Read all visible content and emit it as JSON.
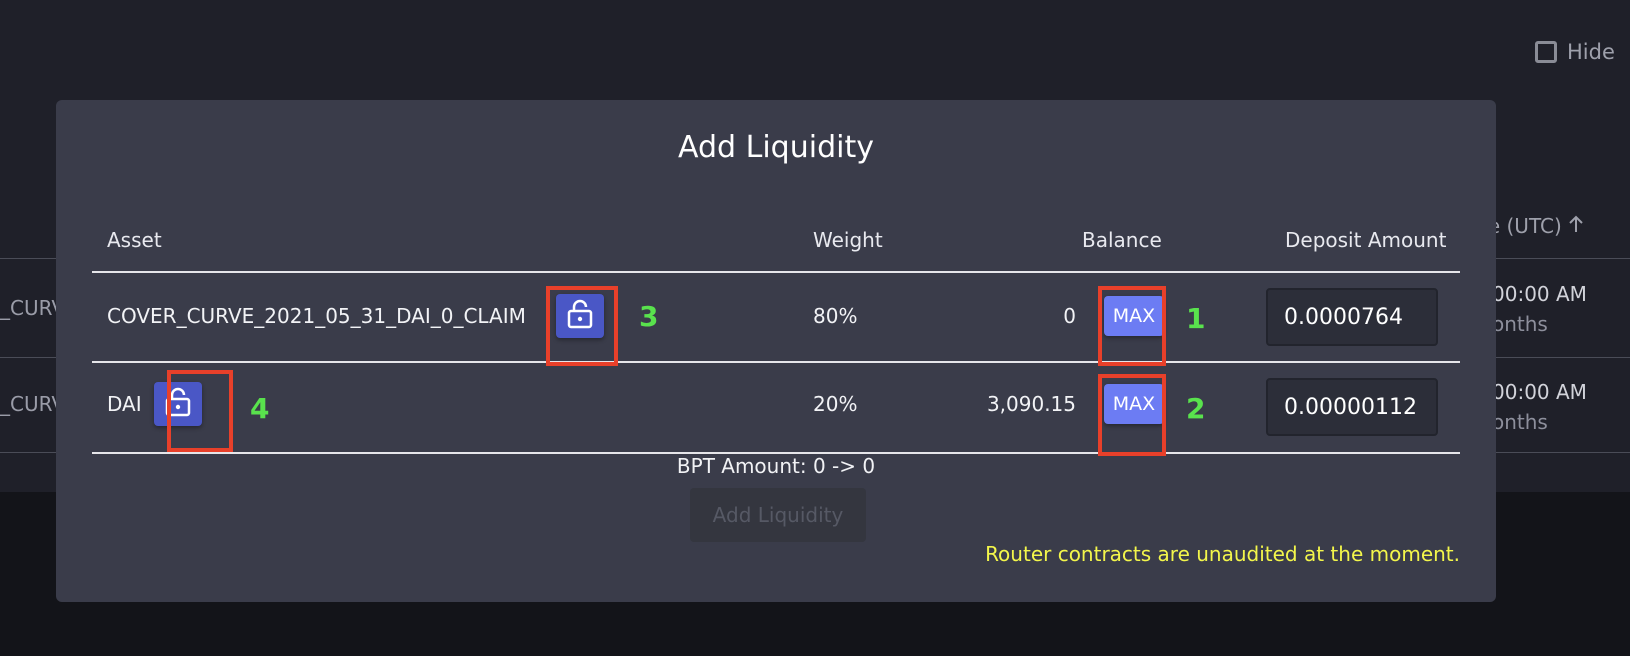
{
  "background": {
    "hide_label": "Hide",
    "date_header": "te (UTC)",
    "sort_icon": "arrow-up-icon",
    "rows": [
      {
        "left_text": "_CURV",
        "time": "00:00 AM",
        "sub": "onths"
      },
      {
        "left_text": "_CURV",
        "time": "00:00 AM",
        "sub": "onths"
      }
    ]
  },
  "modal": {
    "title": "Add Liquidity",
    "headers": {
      "asset": "Asset",
      "weight": "Weight",
      "balance": "Balance",
      "deposit": "Deposit Amount"
    },
    "rows": [
      {
        "asset": "COVER_CURVE_2021_05_31_DAI_0_CLAIM",
        "weight": "80%",
        "balance": "0",
        "max_label": "MAX",
        "deposit_value": "0.0000764",
        "lock_icon": "unlock-icon"
      },
      {
        "asset": "DAI",
        "weight": "20%",
        "balance": "3,090.15",
        "max_label": "MAX",
        "deposit_value": "0.00000112",
        "lock_icon": "unlock-icon"
      }
    ],
    "bpt_amount": "BPT Amount: 0 -> 0",
    "add_button": "Add Liquidity",
    "warning": "Router contracts are unaudited at the moment."
  },
  "annotations": {
    "markers": [
      "1",
      "2",
      "3",
      "4"
    ],
    "box_color": "#e8402a",
    "marker_color": "#59e24d"
  }
}
